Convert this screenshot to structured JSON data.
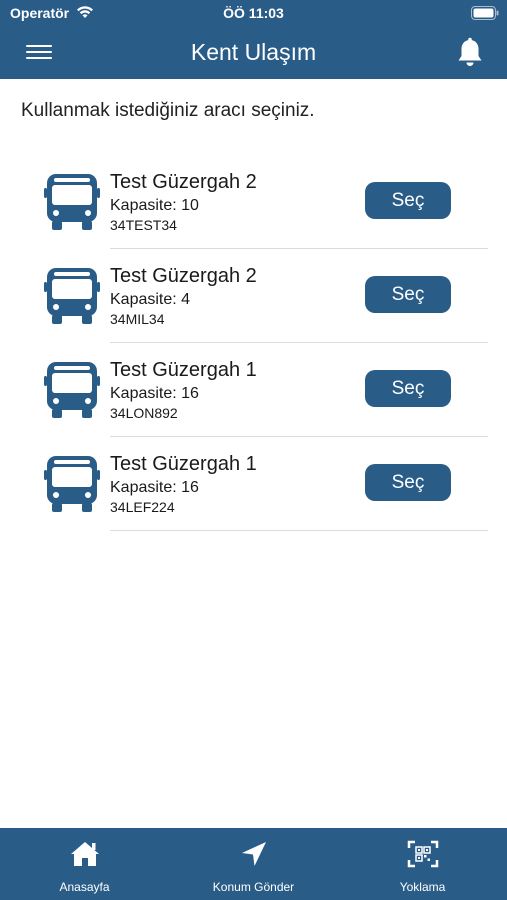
{
  "status_bar": {
    "carrier": "Operatör",
    "time": "ÖÖ 11:03"
  },
  "header": {
    "title": "Kent Ulaşım",
    "menu_icon": "hamburger-menu-icon",
    "notification_icon": "bell-icon"
  },
  "instruction": "Kullanmak istediğiniz aracı seçiniz.",
  "vehicles": [
    {
      "route": "Test Güzergah 2",
      "capacity": "Kapasite: 10",
      "plate": "34TEST34",
      "button": "Seç"
    },
    {
      "route": "Test Güzergah 2",
      "capacity": "Kapasite: 4",
      "plate": "34MIL34",
      "button": "Seç"
    },
    {
      "route": "Test Güzergah 1",
      "capacity": "Kapasite: 16",
      "plate": "34LON892",
      "button": "Seç"
    },
    {
      "route": "Test Güzergah 1",
      "capacity": "Kapasite: 16",
      "plate": "34LEF224",
      "button": "Seç"
    }
  ],
  "tabbar": {
    "items": [
      {
        "label": "Anasayfa",
        "icon": "home-icon"
      },
      {
        "label": "Konum Gönder",
        "icon": "location-arrow-icon"
      },
      {
        "label": "Yoklama",
        "icon": "qr-scan-icon"
      }
    ]
  },
  "colors": {
    "primary": "#2a5c88",
    "background": "#ffffff",
    "separator": "#dcdcdc"
  }
}
